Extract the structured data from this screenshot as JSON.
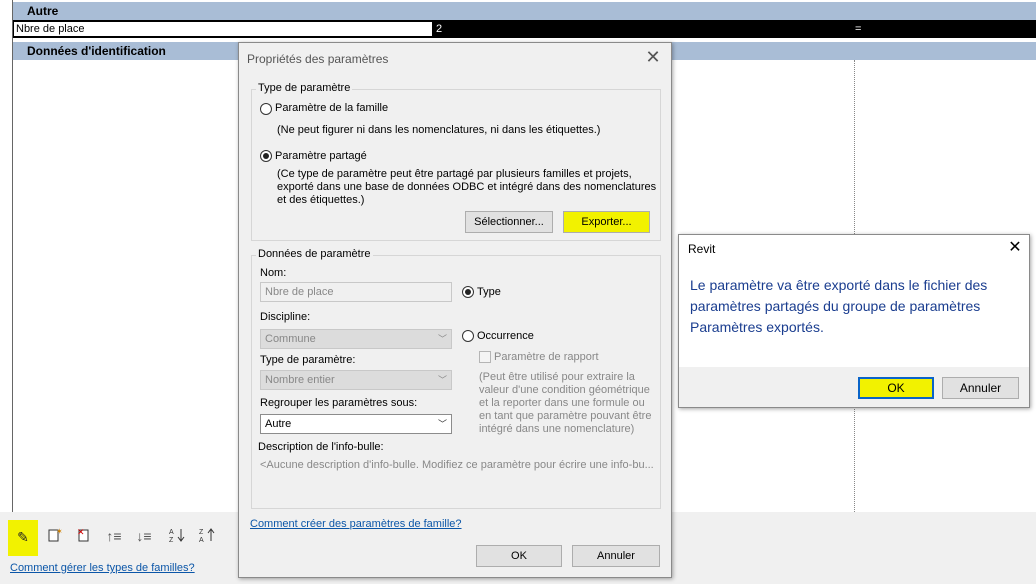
{
  "grid": {
    "group_other": "Autre",
    "row_name": "Nbre de place",
    "row_value": "2",
    "row_formula": "=",
    "group_identification": "Données d'identification"
  },
  "toolbar": {
    "icons": [
      "pencil-icon",
      "new-type-icon",
      "delete-type-icon",
      "move-up-icon",
      "move-down-icon",
      "sort-ascending-icon",
      "sort-descending-icon"
    ]
  },
  "bottom_link": "Comment gérer les types de familles?",
  "dialog": {
    "title": "Propriétés des paramètres",
    "param_type_group": "Type de paramètre",
    "family_param_label": "Paramètre de la famille",
    "family_param_note": "(Ne peut figurer ni dans les nomenclatures, ni dans les étiquettes.)",
    "shared_param_label": "Paramètre partagé",
    "shared_param_note_1": "(Ce type de paramètre peut être partagé par plusieurs familles et projets,",
    "shared_param_note_2": "exporté dans une base de données ODBC et intégré dans des nomenclatures",
    "shared_param_note_3": "et des étiquettes.)",
    "select_button": "Sélectionner...",
    "export_button": "Exporter...",
    "param_data_group": "Données de paramètre",
    "name_label": "Nom:",
    "name_value": "Nbre de place",
    "type_radio": "Type",
    "discipline_label": "Discipline:",
    "discipline_value": "Commune",
    "occurrence_radio": "Occurrence",
    "report_param_label": "Paramètre de rapport",
    "param_type_label": "Type de paramètre:",
    "param_type_value": "Nombre entier",
    "report_note_1": "(Peut être utilisé pour extraire la",
    "report_note_2": "valeur d'une condition géométrique",
    "report_note_3": "et la reporter dans une formule ou",
    "report_note_4": "en tant que paramètre pouvant être",
    "report_note_5": "intégré dans une nomenclature)",
    "group_under_label": "Regrouper les paramètres sous:",
    "group_under_value": "Autre",
    "tooltip_desc_label": "Description de l'info-bulle:",
    "tooltip_desc_value": "<Aucune description d'info-bulle. Modifiez ce paramètre pour écrire une info-bu...",
    "help_link": "Comment créer des paramètres de famille?",
    "ok_button": "OK",
    "cancel_button": "Annuler",
    "close_glyph": "✕"
  },
  "msgbox": {
    "title": "Revit",
    "message_1": "Le paramètre va être exporté dans le fichier des",
    "message_2": "paramètres partagés du groupe de paramètres",
    "message_3": "Paramètres exportés.",
    "ok_button": "OK",
    "cancel_button": "Annuler",
    "close_glyph": "✕"
  },
  "colors": {
    "group_header": "#a9bdd6",
    "highlight": "#f2f200",
    "link": "#0b56a8",
    "message_text": "#1a3d8f"
  }
}
